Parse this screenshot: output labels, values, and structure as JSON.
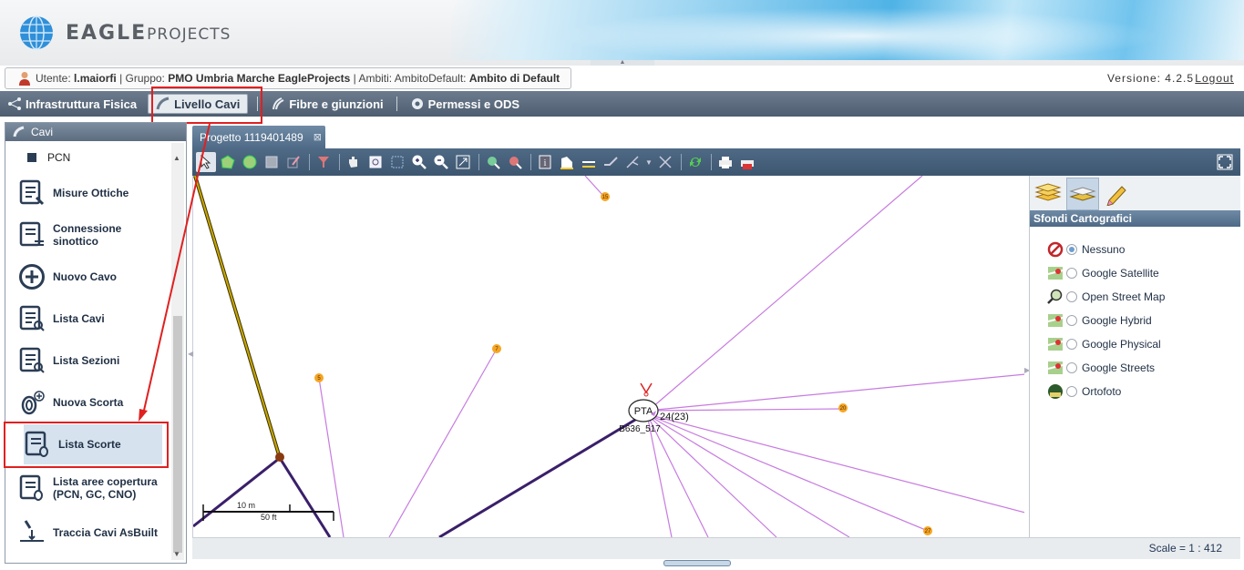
{
  "header": {
    "brand_main": "EAGLE",
    "brand_sub": "PROJECTS"
  },
  "userbar": {
    "user_label": "Utente:",
    "user_value": "l.maiorfi",
    "group_label": "| Gruppo:",
    "group_value": "PMO Umbria Marche EagleProjects",
    "scope_label": "| Ambiti: AmbitoDefault:",
    "scope_value": "Ambito di Default",
    "version": "Versione: 4.2.5",
    "logout": "Logout"
  },
  "menu": {
    "items": [
      {
        "label": "Infrastruttura Fisica",
        "icon": "network-icon"
      },
      {
        "label": "Livello Cavi",
        "icon": "cable-icon",
        "active": true
      },
      {
        "label": "Fibre e giunzioni",
        "icon": "fiber-icon"
      },
      {
        "label": "Permessi e ODS",
        "icon": "gear-icon"
      }
    ]
  },
  "left_panel": {
    "title": "Cavi",
    "items": [
      {
        "label": "PCN"
      },
      {
        "label": "Misure Ottiche"
      },
      {
        "label": "Connessione sinottico"
      },
      {
        "label": "Nuovo Cavo"
      },
      {
        "label": "Lista Cavi"
      },
      {
        "label": "Lista Sezioni"
      },
      {
        "label": "Nuova Scorta"
      },
      {
        "label": "Lista Scorte"
      },
      {
        "label": "Lista aree copertura (PCN, GC, CNO)"
      },
      {
        "label": "Traccia Cavi AsBuilt"
      }
    ]
  },
  "map": {
    "tab_title": "Progetto 1119401489",
    "node_label": "PTA",
    "node_id": "B636_517",
    "node_count": "24(23)",
    "scale_m": "10 m",
    "scale_ft": "50 ft",
    "scale_text": "Scale = 1 : 412",
    "markers": [
      "15",
      "7",
      "5",
      "20",
      "27"
    ]
  },
  "right_panel": {
    "title": "Sfondi Cartografici",
    "options": [
      {
        "label": "Nessuno",
        "icon": "no-entry-icon",
        "selected": true
      },
      {
        "label": "Google Satellite",
        "icon": "google-map-icon",
        "selected": false
      },
      {
        "label": "Open Street Map",
        "icon": "magnifier-map-icon",
        "selected": false
      },
      {
        "label": "Google Hybrid",
        "icon": "google-map-icon",
        "selected": false
      },
      {
        "label": "Google Physical",
        "icon": "google-map-icon",
        "selected": false
      },
      {
        "label": "Google Streets",
        "icon": "google-map-icon",
        "selected": false
      },
      {
        "label": "Ortofoto",
        "icon": "ortofoto-icon",
        "selected": false
      }
    ]
  },
  "colors": {
    "accent": "#4e6a86",
    "highlight": "#e02020",
    "cable_purple": "#c77be0",
    "cable_dark": "#3a1f6a",
    "cable_yellow": "#c9a800",
    "marker": "#f5a623"
  }
}
